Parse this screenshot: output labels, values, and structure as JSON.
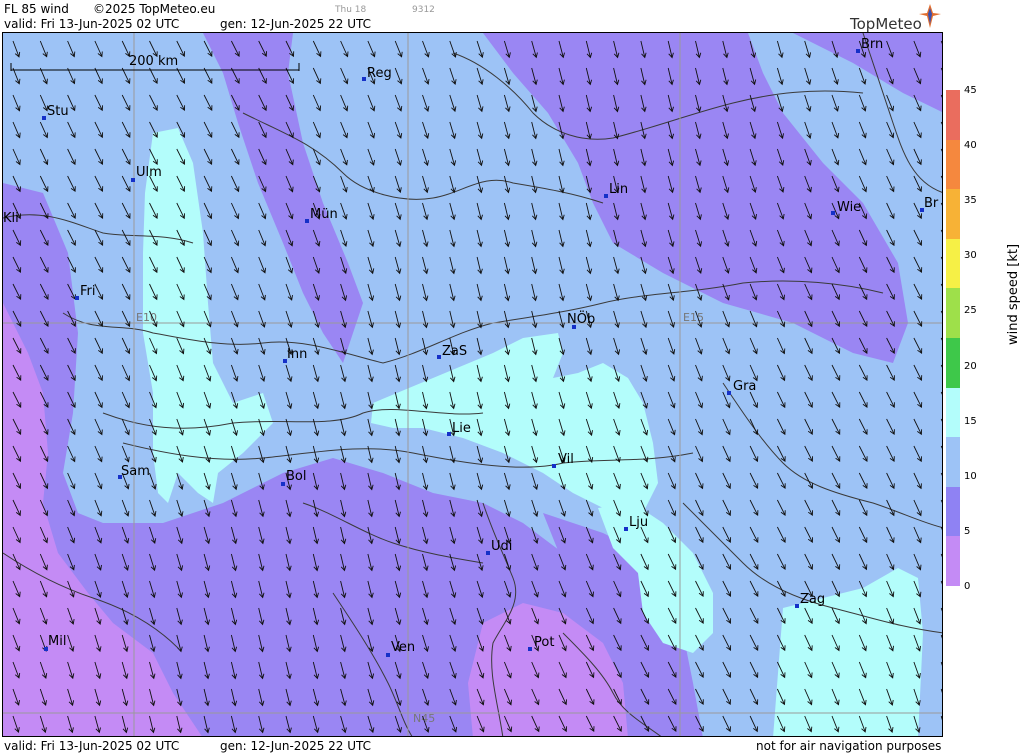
{
  "header": {
    "product": "FL 85 wind",
    "copyright": "©2025 TopMeteo.eu",
    "valid": "valid:  Fri  13-Jun-2025  02 UTC",
    "generated": "gen: 12-Jun-2025 22 UTC",
    "small_day": "Thu 18",
    "small_code": "9312"
  },
  "logo": {
    "text": "TopMeteo"
  },
  "map": {
    "scale_label": "200 km",
    "grid_labels": {
      "lon_10": "E10",
      "lon_15": "E15",
      "lat_45": "N45"
    },
    "cities": [
      {
        "id": "brn",
        "label": "Brn"
      },
      {
        "id": "reg",
        "label": "Reg"
      },
      {
        "id": "stu",
        "label": "Stu"
      },
      {
        "id": "ulm",
        "label": "Ulm"
      },
      {
        "id": "lin",
        "label": "Lin"
      },
      {
        "id": "wie",
        "label": "Wie"
      },
      {
        "id": "br",
        "label": "Br"
      },
      {
        "id": "kli",
        "label": "Kli"
      },
      {
        "id": "mun",
        "label": "Mün"
      },
      {
        "id": "fri",
        "label": "Fri"
      },
      {
        "id": "nob",
        "label": "NÖb"
      },
      {
        "id": "inn",
        "label": "Inn"
      },
      {
        "id": "zas",
        "label": "ZaS"
      },
      {
        "id": "gra",
        "label": "Gra"
      },
      {
        "id": "lie",
        "label": "Lie"
      },
      {
        "id": "vil",
        "label": "Vil"
      },
      {
        "id": "sam",
        "label": "Sam"
      },
      {
        "id": "bol",
        "label": "Bol"
      },
      {
        "id": "lju",
        "label": "Lju"
      },
      {
        "id": "udi",
        "label": "Udi"
      },
      {
        "id": "zag",
        "label": "Zag"
      },
      {
        "id": "mil",
        "label": "Mil"
      },
      {
        "id": "ven",
        "label": "Ven"
      },
      {
        "id": "pot",
        "label": "Pot"
      }
    ],
    "colors": {
      "band_0_5": "#c48bf5",
      "band_5_10": "#9a86f3",
      "band_10_15": "#9dc3f6",
      "band_15_20": "#b3fdfb"
    }
  },
  "legend": {
    "title": "wind  speed  [kt]",
    "ticks": [
      "45",
      "40",
      "35",
      "30",
      "25",
      "20",
      "15",
      "10",
      "5",
      "0"
    ],
    "colors": [
      "#ea6d5e",
      "#f5883e",
      "#f7b236",
      "#f6f046",
      "#9ee04a",
      "#3ec84a",
      "#b3fdfb",
      "#9dc3f6",
      "#8f82f3",
      "#c48bf5"
    ]
  },
  "footer": {
    "valid": "valid:  Fri  13-Jun-2025  02 UTC",
    "generated": "gen: 12-Jun-2025 22 UTC",
    "disclaimer": "not for air navigation purposes"
  }
}
